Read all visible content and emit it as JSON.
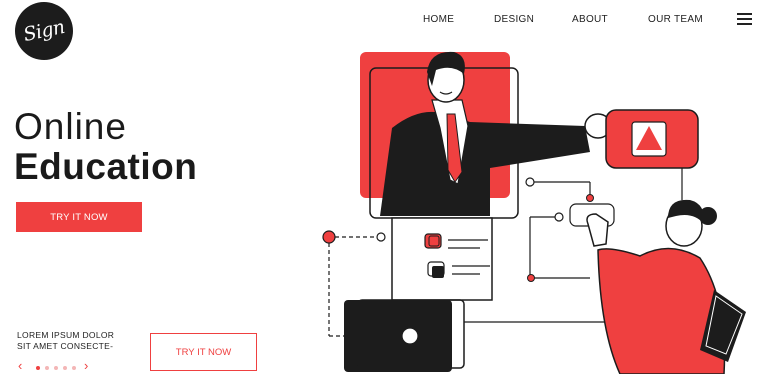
{
  "brand": {
    "logo_text": "Sign"
  },
  "nav": {
    "items": [
      {
        "label": "HOME"
      },
      {
        "label": "DESIGN"
      },
      {
        "label": "ABOUT"
      },
      {
        "label": "OUR TEAM"
      }
    ],
    "menu_icon": "hamburger-menu-icon"
  },
  "hero": {
    "title_line1": "Online",
    "title_line2": "Education",
    "cta_label": "TRY IT NOW"
  },
  "footer": {
    "lorem_line1": "LOREM IPSUM DOLOR",
    "lorem_line2": "SIT AMET CONSECTE-",
    "cta_label": "TRY IT NOW",
    "pager": {
      "prev_icon": "chevron-left-icon",
      "next_icon": "chevron-right-icon",
      "total": 5,
      "active": 1
    }
  },
  "colors": {
    "accent": "#ef4040",
    "dark": "#1c1c1c",
    "dot_inactive": "#f4b6b6"
  },
  "illustration": {
    "name": "online-education-illustration"
  }
}
